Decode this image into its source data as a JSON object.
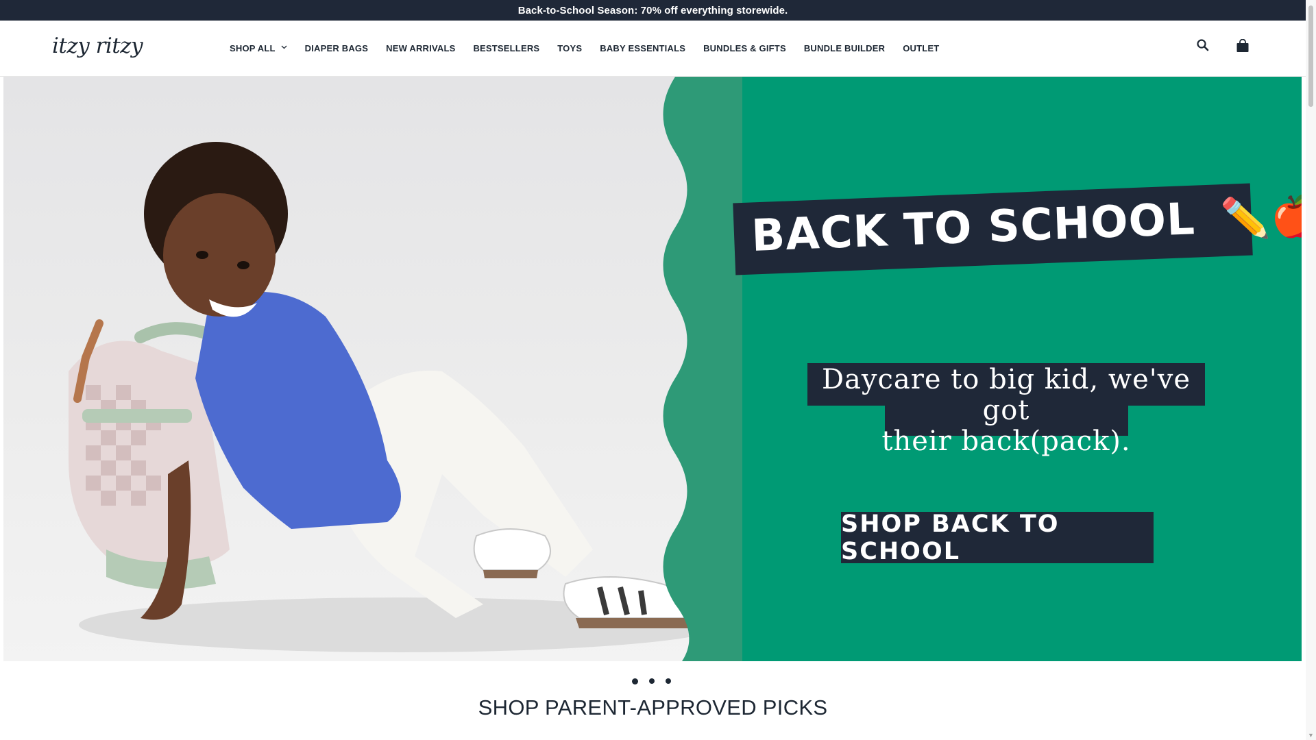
{
  "announcement": {
    "text": "Back-to-School Season: 70% off everything storewide."
  },
  "header": {
    "logo_text": "itzy ritzy",
    "nav": [
      {
        "label": "SHOP ALL",
        "has_dropdown": true
      },
      {
        "label": "DIAPER BAGS"
      },
      {
        "label": "NEW ARRIVALS"
      },
      {
        "label": "BESTSELLERS"
      },
      {
        "label": "TOYS"
      },
      {
        "label": "BABY ESSENTIALS"
      },
      {
        "label": "BUNDLES & GIFTS"
      },
      {
        "label": "BUNDLE BUILDER"
      },
      {
        "label": "OUTLET"
      }
    ],
    "icons": [
      "search-icon",
      "shopping-bag-icon"
    ]
  },
  "hero": {
    "title": "BACK TO SCHOOL",
    "title_emoji": "pencil and apple",
    "subtitle_line1": "Daycare to big kid, we've got",
    "subtitle_line2": "their back(pack).",
    "cta_label": "SHOP BACK TO SCHOOL",
    "image": "child-with-checkered-backpack",
    "slides_count": 3,
    "active_slide": 1
  },
  "section": {
    "title": "SHOP PARENT-APPROVED PICKS"
  },
  "colors": {
    "brand_green": "#009a74",
    "navy": "#1f2838"
  }
}
